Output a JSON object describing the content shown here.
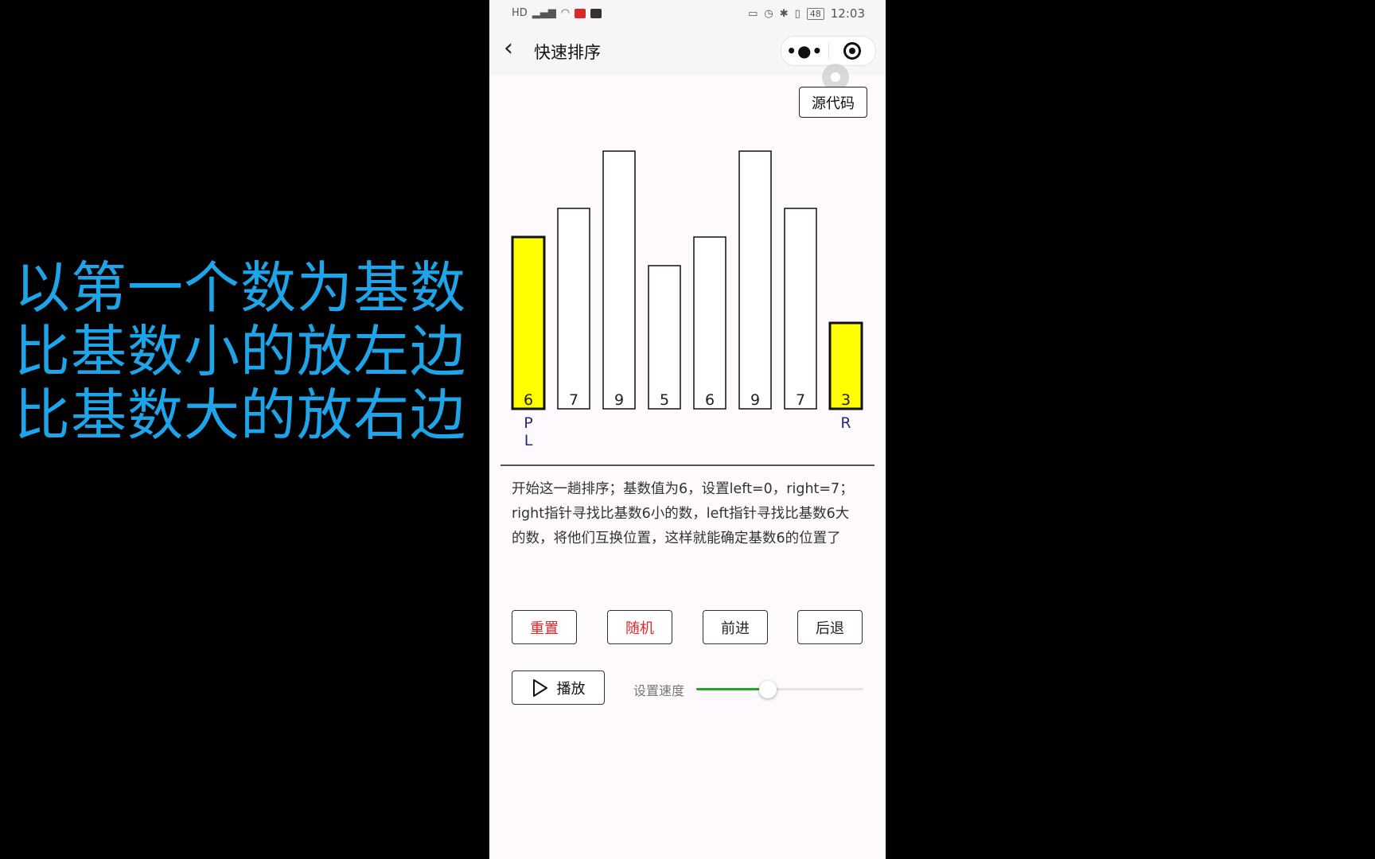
{
  "caption": {
    "lines": [
      "以第一个数为基数",
      "比基数小的放左边",
      "比基数大的放右边"
    ],
    "color": "#1ea4e8"
  },
  "status_bar": {
    "left_icons": [
      "hd-icon",
      "signal-icon",
      "wifi-icon",
      "mic-app-icon",
      "app-icon"
    ],
    "time": "12:03",
    "battery": "48",
    "right_icons": [
      "cast-icon",
      "alarm-icon",
      "bluetooth-icon",
      "vibrate-icon",
      "battery-icon"
    ]
  },
  "nav": {
    "title": "快速排序",
    "back_icon": "chevron-left-icon",
    "more_icon": "more-dots-icon",
    "close_icon": "target-circle-icon"
  },
  "source_button": "源代码",
  "chart_data": {
    "type": "bar",
    "values": [
      6,
      7,
      9,
      5,
      6,
      9,
      7,
      3
    ],
    "highlighted": [
      0,
      7
    ],
    "highlight_color": "#ffff00",
    "default_color": "#ffffff",
    "pointer_labels": [
      {
        "index": 0,
        "labels": [
          "P",
          "L"
        ]
      },
      {
        "index": 7,
        "labels": [
          "R"
        ]
      }
    ],
    "pointer_color": "#2a2a7a",
    "ylim": [
      0,
      10
    ]
  },
  "description": "开始这一趟排序；基数值为6，设置left=0，right=7；right指针寻找比基数6小的数，left指针寻找比基数6大的数，将他们互换位置，这样就能确定基数6的位置了",
  "controls": {
    "reset": "重置",
    "random": "随机",
    "forward": "前进",
    "backward": "后退",
    "play": "播放",
    "speed_label": "设置速度",
    "speed_value": 0.43,
    "accent_red": "#e0282e",
    "slider_color": "#1aad19"
  }
}
